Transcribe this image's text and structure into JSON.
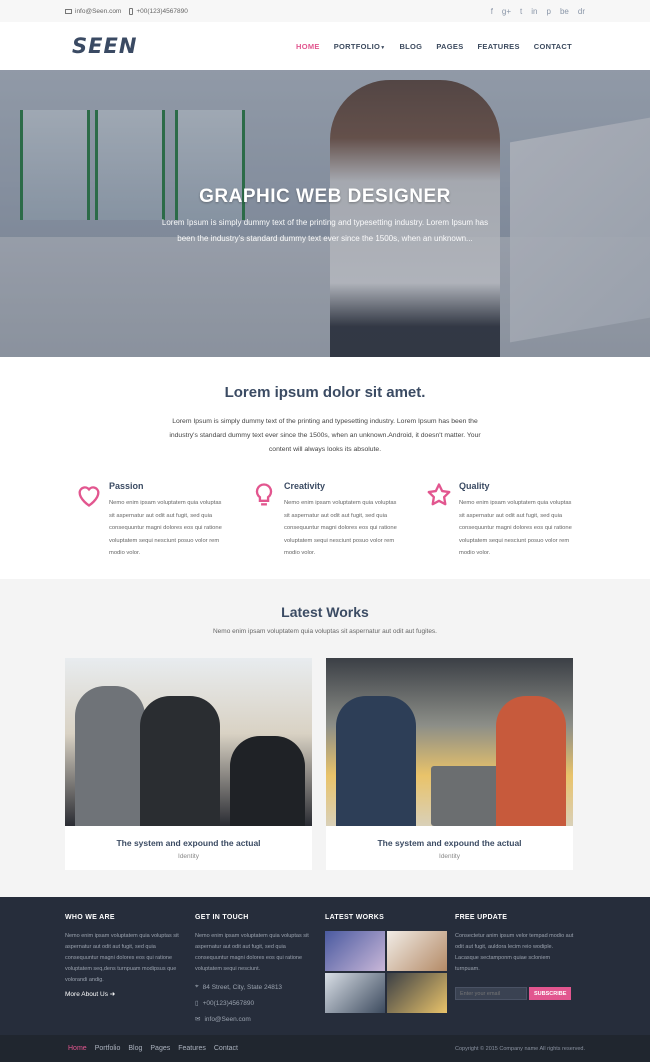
{
  "topbar": {
    "email": "info@Seen.com",
    "phone": "+00(123)4567890",
    "social": [
      "f",
      "g+",
      "t",
      "in",
      "p",
      "be",
      "dr"
    ]
  },
  "nav": {
    "logo": "SEEN",
    "items": [
      {
        "label": "HOME",
        "active": true
      },
      {
        "label": "PORTFOLIO",
        "dropdown": true
      },
      {
        "label": "BLOG"
      },
      {
        "label": "PAGES"
      },
      {
        "label": "FEATURES"
      },
      {
        "label": "CONTACT"
      }
    ]
  },
  "hero": {
    "title": "GRAPHIC WEB DESIGNER",
    "text": "Lorem Ipsum is simply dummy text of the printing and typesetting industry. Lorem Ipsum has been the industry's standard dummy text ever since the 1500s, when an unknown..."
  },
  "about": {
    "title": "Lorem ipsum dolor sit amet.",
    "text": "Lorem Ipsum is simply dummy text of the printing and typesetting industry. Lorem Ipsum has been the industry's standard dummy text ever since the 1500s, when an unknown.Android, it doesn't matter. Your content will always looks its absolute.",
    "features": [
      {
        "title": "Passion",
        "icon": "heart-icon",
        "glyph": "♡",
        "text": "Nemo enim ipsam voluptatem quia voluptas sit aspernatur aut odit aut fugit, sed quia consequuntur magni dolores eos qui ratione voluptatem sequi nesciunt posuo volor rem modio volor."
      },
      {
        "title": "Creativity",
        "icon": "lightbulb-icon",
        "glyph": "💡",
        "text": "Nemo enim ipsam voluptatem quia voluptas sit aspernatur aut odit aut fugit, sed quia consequuntur magni dolores eos qui ratione voluptatem sequi nesciunt posuo volor rem modio volor."
      },
      {
        "title": "Quality",
        "icon": "star-icon",
        "glyph": "☆",
        "text": "Nemo enim ipsam voluptatem quia voluptas sit aspernatur aut odit aut fugit, sed quia consequuntur magni dolores eos qui ratione voluptatem sequi nesciunt posuo volor rem modio volor."
      }
    ]
  },
  "works": {
    "title": "Latest Works",
    "subtitle": "Nemo enim ipsam voluptatem quia voluptas sit aspernatur aut odit aut fugites.",
    "cards": [
      {
        "title": "The system and expound the actual",
        "tag": "Identity"
      },
      {
        "title": "The system and expound the actual",
        "tag": "Identity"
      }
    ]
  },
  "footer": {
    "who": {
      "title": "WHO WE ARE",
      "text": "Nemo enim ipsam voluptatem quia voluptas sit aspernatur aut odit aut fugit, sed quia consequuntur magni dolores eos qui ratione voluptatem seq,dens turnpuam modipsus que volorandi andig.",
      "more": "More About Us ➜"
    },
    "touch": {
      "title": "GET IN TOUCH",
      "text": "Nemo enim ipsam voluptatem quia voluptas sit aspernatur aut odit aut fugit, sed quia consequuntur magni dolores eos qui ratione voluptatem sequi nesciunt.",
      "address": "84 Street, City, State 24813",
      "phone": "+00(123)4567890",
      "email": "info@Seen.com"
    },
    "latest": {
      "title": "LATEST WORKS"
    },
    "update": {
      "title": "FREE UPDATE",
      "text": "Consectetur anim ipsum velor tempad modio aut odit aut fugit, auldora lecim reio wodiple. Lacasque sectamponm quiae scloniem turnpuam.",
      "placeholder": "Enter your email",
      "button": "SUBSCRIBE"
    }
  },
  "bottom": {
    "links": [
      {
        "label": "Home",
        "active": true
      },
      {
        "label": "Portfolio"
      },
      {
        "label": "Blog"
      },
      {
        "label": "Pages"
      },
      {
        "label": "Features"
      },
      {
        "label": "Contact"
      }
    ],
    "copyright": "Copyright © 2015 Company name All rights reserved."
  },
  "colors": {
    "accent": "#e2568f",
    "navy": "#3b4b63",
    "footer": "#262d3b"
  }
}
